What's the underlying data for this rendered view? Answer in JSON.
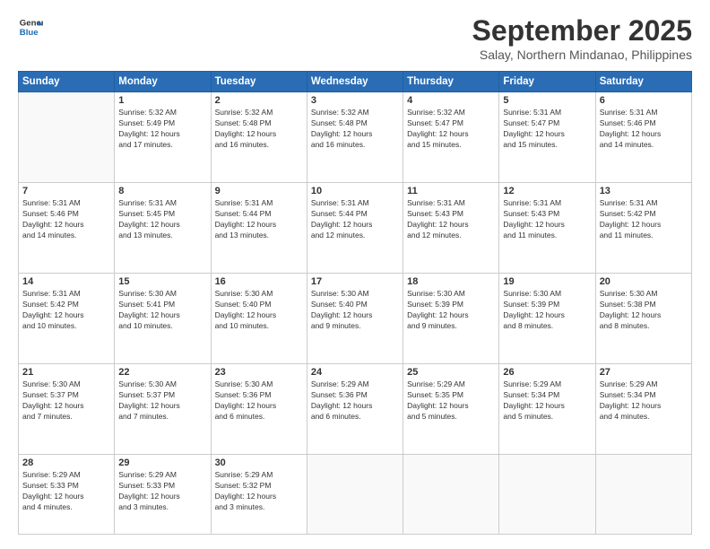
{
  "header": {
    "logo_line1": "General",
    "logo_line2": "Blue",
    "month": "September 2025",
    "location": "Salay, Northern Mindanao, Philippines"
  },
  "weekdays": [
    "Sunday",
    "Monday",
    "Tuesday",
    "Wednesday",
    "Thursday",
    "Friday",
    "Saturday"
  ],
  "weeks": [
    [
      {
        "day": "",
        "info": ""
      },
      {
        "day": "1",
        "info": "Sunrise: 5:32 AM\nSunset: 5:49 PM\nDaylight: 12 hours\nand 17 minutes."
      },
      {
        "day": "2",
        "info": "Sunrise: 5:32 AM\nSunset: 5:48 PM\nDaylight: 12 hours\nand 16 minutes."
      },
      {
        "day": "3",
        "info": "Sunrise: 5:32 AM\nSunset: 5:48 PM\nDaylight: 12 hours\nand 16 minutes."
      },
      {
        "day": "4",
        "info": "Sunrise: 5:32 AM\nSunset: 5:47 PM\nDaylight: 12 hours\nand 15 minutes."
      },
      {
        "day": "5",
        "info": "Sunrise: 5:31 AM\nSunset: 5:47 PM\nDaylight: 12 hours\nand 15 minutes."
      },
      {
        "day": "6",
        "info": "Sunrise: 5:31 AM\nSunset: 5:46 PM\nDaylight: 12 hours\nand 14 minutes."
      }
    ],
    [
      {
        "day": "7",
        "info": "Sunrise: 5:31 AM\nSunset: 5:46 PM\nDaylight: 12 hours\nand 14 minutes."
      },
      {
        "day": "8",
        "info": "Sunrise: 5:31 AM\nSunset: 5:45 PM\nDaylight: 12 hours\nand 13 minutes."
      },
      {
        "day": "9",
        "info": "Sunrise: 5:31 AM\nSunset: 5:44 PM\nDaylight: 12 hours\nand 13 minutes."
      },
      {
        "day": "10",
        "info": "Sunrise: 5:31 AM\nSunset: 5:44 PM\nDaylight: 12 hours\nand 12 minutes."
      },
      {
        "day": "11",
        "info": "Sunrise: 5:31 AM\nSunset: 5:43 PM\nDaylight: 12 hours\nand 12 minutes."
      },
      {
        "day": "12",
        "info": "Sunrise: 5:31 AM\nSunset: 5:43 PM\nDaylight: 12 hours\nand 11 minutes."
      },
      {
        "day": "13",
        "info": "Sunrise: 5:31 AM\nSunset: 5:42 PM\nDaylight: 12 hours\nand 11 minutes."
      }
    ],
    [
      {
        "day": "14",
        "info": "Sunrise: 5:31 AM\nSunset: 5:42 PM\nDaylight: 12 hours\nand 10 minutes."
      },
      {
        "day": "15",
        "info": "Sunrise: 5:30 AM\nSunset: 5:41 PM\nDaylight: 12 hours\nand 10 minutes."
      },
      {
        "day": "16",
        "info": "Sunrise: 5:30 AM\nSunset: 5:40 PM\nDaylight: 12 hours\nand 10 minutes."
      },
      {
        "day": "17",
        "info": "Sunrise: 5:30 AM\nSunset: 5:40 PM\nDaylight: 12 hours\nand 9 minutes."
      },
      {
        "day": "18",
        "info": "Sunrise: 5:30 AM\nSunset: 5:39 PM\nDaylight: 12 hours\nand 9 minutes."
      },
      {
        "day": "19",
        "info": "Sunrise: 5:30 AM\nSunset: 5:39 PM\nDaylight: 12 hours\nand 8 minutes."
      },
      {
        "day": "20",
        "info": "Sunrise: 5:30 AM\nSunset: 5:38 PM\nDaylight: 12 hours\nand 8 minutes."
      }
    ],
    [
      {
        "day": "21",
        "info": "Sunrise: 5:30 AM\nSunset: 5:37 PM\nDaylight: 12 hours\nand 7 minutes."
      },
      {
        "day": "22",
        "info": "Sunrise: 5:30 AM\nSunset: 5:37 PM\nDaylight: 12 hours\nand 7 minutes."
      },
      {
        "day": "23",
        "info": "Sunrise: 5:30 AM\nSunset: 5:36 PM\nDaylight: 12 hours\nand 6 minutes."
      },
      {
        "day": "24",
        "info": "Sunrise: 5:29 AM\nSunset: 5:36 PM\nDaylight: 12 hours\nand 6 minutes."
      },
      {
        "day": "25",
        "info": "Sunrise: 5:29 AM\nSunset: 5:35 PM\nDaylight: 12 hours\nand 5 minutes."
      },
      {
        "day": "26",
        "info": "Sunrise: 5:29 AM\nSunset: 5:34 PM\nDaylight: 12 hours\nand 5 minutes."
      },
      {
        "day": "27",
        "info": "Sunrise: 5:29 AM\nSunset: 5:34 PM\nDaylight: 12 hours\nand 4 minutes."
      }
    ],
    [
      {
        "day": "28",
        "info": "Sunrise: 5:29 AM\nSunset: 5:33 PM\nDaylight: 12 hours\nand 4 minutes."
      },
      {
        "day": "29",
        "info": "Sunrise: 5:29 AM\nSunset: 5:33 PM\nDaylight: 12 hours\nand 3 minutes."
      },
      {
        "day": "30",
        "info": "Sunrise: 5:29 AM\nSunset: 5:32 PM\nDaylight: 12 hours\nand 3 minutes."
      },
      {
        "day": "",
        "info": ""
      },
      {
        "day": "",
        "info": ""
      },
      {
        "day": "",
        "info": ""
      },
      {
        "day": "",
        "info": ""
      }
    ]
  ]
}
